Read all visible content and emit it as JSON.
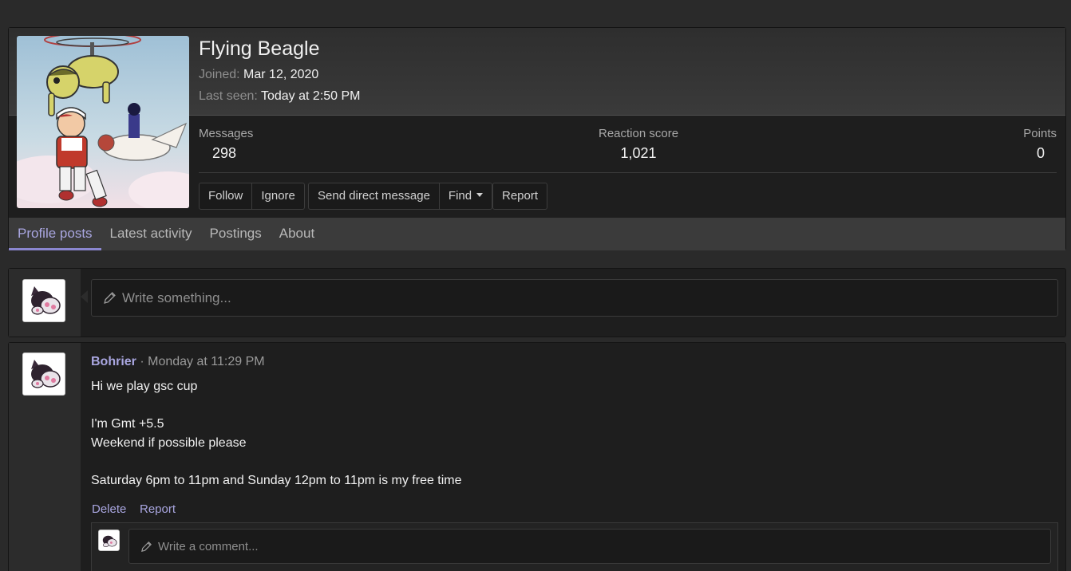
{
  "profile": {
    "name": "Flying Beagle",
    "joined_label": "Joined:",
    "joined_value": "Mar 12, 2020",
    "last_seen_label": "Last seen:",
    "last_seen_value": "Today at 2:50 PM",
    "stats": {
      "messages_label": "Messages",
      "messages_value": "298",
      "reaction_label": "Reaction score",
      "reaction_value": "1,021",
      "points_label": "Points",
      "points_value": "0"
    },
    "buttons": {
      "follow": "Follow",
      "ignore": "Ignore",
      "send_dm": "Send direct message",
      "find": "Find",
      "report": "Report"
    }
  },
  "tabs": [
    {
      "label": "Profile posts",
      "active": true
    },
    {
      "label": "Latest activity"
    },
    {
      "label": "Postings"
    },
    {
      "label": "About"
    }
  ],
  "composer": {
    "placeholder": "Write something..."
  },
  "post": {
    "author": "Bohrier",
    "separator": " · ",
    "time": "Monday at 11:29 PM",
    "lines": [
      "Hi we play gsc cup",
      "I'm Gmt +5.5",
      "Weekend if possible please",
      "Saturday 6pm to 11pm and Sunday 12pm to 11pm is my free time"
    ],
    "actions": {
      "delete": "Delete",
      "report": "Report"
    },
    "comment_placeholder": "Write a comment..."
  },
  "colors": {
    "accent": "#a9a6e0",
    "background": "#2a2a2a",
    "panel": "#1e1e1e"
  }
}
